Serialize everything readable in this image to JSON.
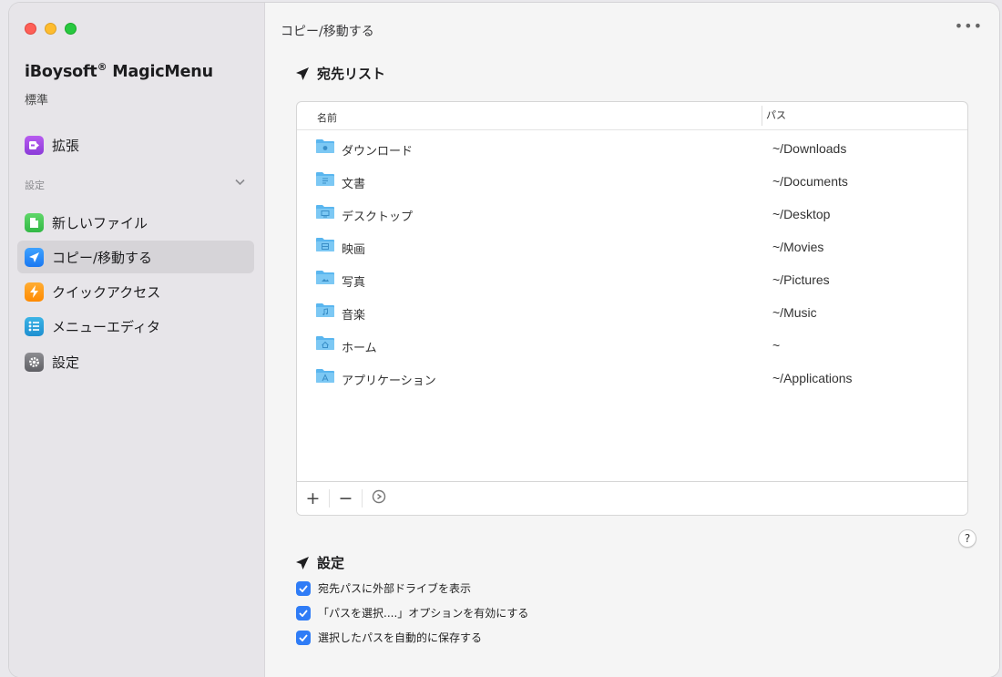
{
  "sidebar": {
    "app_name": "iBoysoft",
    "app_name_reg": "®",
    "app_name_suffix": " MagicMenu",
    "edition": "標準",
    "settings_group_label": "設定",
    "items": [
      {
        "label": "拡張",
        "icon": "extension-icon",
        "color": "#a24ee6"
      },
      {
        "label": "新しいファイル",
        "icon": "new-file-icon",
        "color": "#45c653"
      },
      {
        "label": "コピー/移動する",
        "icon": "send-icon",
        "color": "#2a8cfa"
      },
      {
        "label": "クイックアクセス",
        "icon": "lightning-icon",
        "color": "#ff9a14"
      },
      {
        "label": "メニューエディタ",
        "icon": "list-icon",
        "color": "#2aa2dd"
      },
      {
        "label": "設定",
        "icon": "gear-icon",
        "color": "#76767b"
      }
    ]
  },
  "main": {
    "title": "コピー/移動する",
    "more_label": "•••",
    "destinations_heading": "宛先リスト",
    "table": {
      "col_name": "名前",
      "col_path": "パス",
      "rows": [
        {
          "name": "ダウンロード",
          "path": "~/Downloads",
          "icon": "downloads-folder-icon"
        },
        {
          "name": "文書",
          "path": "~/Documents",
          "icon": "documents-folder-icon"
        },
        {
          "name": "デスクトップ",
          "path": "~/Desktop",
          "icon": "desktop-folder-icon"
        },
        {
          "name": "映画",
          "path": "~/Movies",
          "icon": "movies-folder-icon"
        },
        {
          "name": "写真",
          "path": "~/Pictures",
          "icon": "pictures-folder-icon"
        },
        {
          "name": "音楽",
          "path": "~/Music",
          "icon": "music-folder-icon"
        },
        {
          "name": "ホーム",
          "path": "~",
          "icon": "home-folder-icon"
        },
        {
          "name": "アプリケーション",
          "path": "~/Applications",
          "icon": "applications-folder-icon"
        }
      ],
      "add_label": "+",
      "remove_label": "−",
      "options_label": "⊙"
    },
    "help_label": "?",
    "settings_heading": "設定",
    "options": [
      {
        "label": "宛先パスに外部ドライブを表示",
        "checked": true
      },
      {
        "label": "「パスを選択....」オプションを有効にする",
        "checked": true
      },
      {
        "label": "選択したパスを自動的に保存する",
        "checked": true
      }
    ]
  },
  "colors": {
    "accent": "#2f7cf6",
    "folder": "#5ab6ef",
    "sidebar_bg": "#e7e5e9",
    "active_item_bg": "#d6d4d8"
  }
}
